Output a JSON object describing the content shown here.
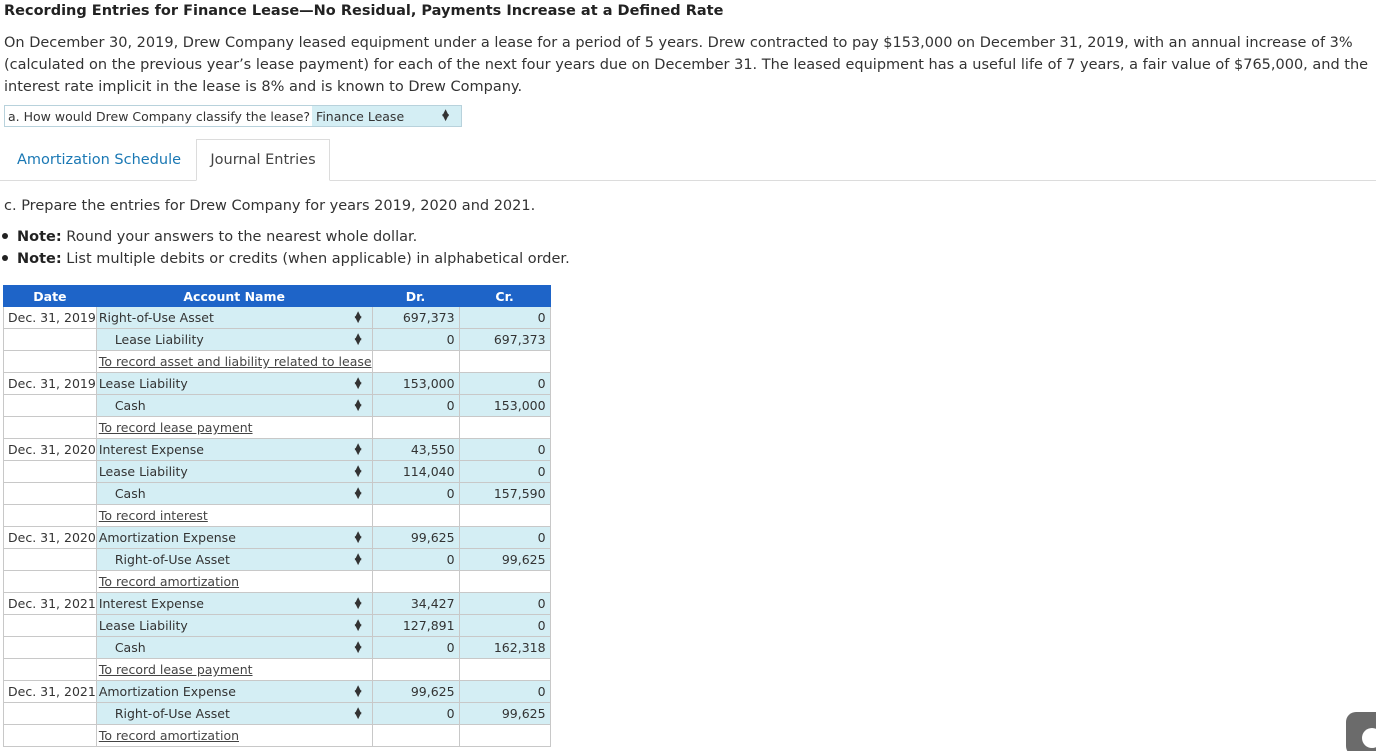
{
  "title": "Recording Entries for Finance Lease—No Residual, Payments Increase at a Defined Rate",
  "intro": "On December 30, 2019, Drew Company leased equipment under a lease for a period of 5 years. Drew contracted to pay $153,000 on December 31, 2019, with an annual increase of 3% (calculated on the previous year’s lease payment) for each of the next four years due on December 31. The leased equipment has a useful life of 7 years, a fair value of $765,000, and the interest rate implicit in the lease is 8% and is known to Drew Company.",
  "classify": {
    "question": "a. How would Drew Company classify the lease?",
    "selected": "Finance Lease"
  },
  "tabs": [
    {
      "label": "Amortization Schedule"
    },
    {
      "label": "Journal Entries"
    }
  ],
  "instruction": "c. Prepare the entries for Drew Company for years 2019, 2020 and 2021.",
  "notes": [
    {
      "label": "Note:",
      "text": " Round your answers to the nearest whole dollar."
    },
    {
      "label": "Note:",
      "text": " List multiple debits or credits (when applicable) in alphabetical order."
    }
  ],
  "table": {
    "headers": {
      "date": "Date",
      "account": "Account Name",
      "dr": "Dr.",
      "cr": "Cr."
    },
    "rows": [
      {
        "type": "entry",
        "date": "Dec. 31, 2019",
        "account": "Right-of-Use Asset",
        "credit": false,
        "dr": "697,373",
        "cr": "0"
      },
      {
        "type": "entry",
        "date": "",
        "account": "Lease Liability",
        "credit": true,
        "dr": "0",
        "cr": "697,373"
      },
      {
        "type": "memo",
        "text": "To record asset and liability related to lease"
      },
      {
        "type": "entry",
        "date": "Dec. 31, 2019",
        "account": "Lease Liability",
        "credit": false,
        "dr": "153,000",
        "cr": "0"
      },
      {
        "type": "entry",
        "date": "",
        "account": "Cash",
        "credit": true,
        "dr": "0",
        "cr": "153,000"
      },
      {
        "type": "memo",
        "text": "To record lease payment"
      },
      {
        "type": "entry",
        "date": "Dec. 31, 2020",
        "account": "Interest Expense",
        "credit": false,
        "dr": "43,550",
        "cr": "0"
      },
      {
        "type": "entry",
        "date": "",
        "account": "Lease Liability",
        "credit": false,
        "dr": "114,040",
        "cr": "0"
      },
      {
        "type": "entry",
        "date": "",
        "account": "Cash",
        "credit": true,
        "dr": "0",
        "cr": "157,590"
      },
      {
        "type": "memo",
        "text": "To record interest"
      },
      {
        "type": "entry",
        "date": "Dec. 31, 2020",
        "account": "Amortization Expense",
        "credit": false,
        "dr": "99,625",
        "cr": "0"
      },
      {
        "type": "entry",
        "date": "",
        "account": "Right-of-Use Asset",
        "credit": true,
        "dr": "0",
        "cr": "99,625"
      },
      {
        "type": "memo",
        "text": "To record amortization"
      },
      {
        "type": "entry",
        "date": "Dec. 31, 2021",
        "account": "Interest Expense",
        "credit": false,
        "dr": "34,427",
        "cr": "0"
      },
      {
        "type": "entry",
        "date": "",
        "account": "Lease Liability",
        "credit": false,
        "dr": "127,891",
        "cr": "0"
      },
      {
        "type": "entry",
        "date": "",
        "account": "Cash",
        "credit": true,
        "dr": "0",
        "cr": "162,318"
      },
      {
        "type": "memo",
        "text": "To record lease payment"
      },
      {
        "type": "entry",
        "date": "Dec. 31, 2021",
        "account": "Amortization Expense",
        "credit": false,
        "dr": "99,625",
        "cr": "0"
      },
      {
        "type": "entry",
        "date": "",
        "account": "Right-of-Use Asset",
        "credit": true,
        "dr": "0",
        "cr": "99,625"
      },
      {
        "type": "memo",
        "text": "To record amortization"
      }
    ]
  },
  "icons": {
    "select": "updown-arrows-icon",
    "scroll": "scroll-top-icon"
  },
  "colors": {
    "header": "#1e64c8",
    "input_bg": "#d4eef4",
    "tab_link": "#1a78b4"
  }
}
